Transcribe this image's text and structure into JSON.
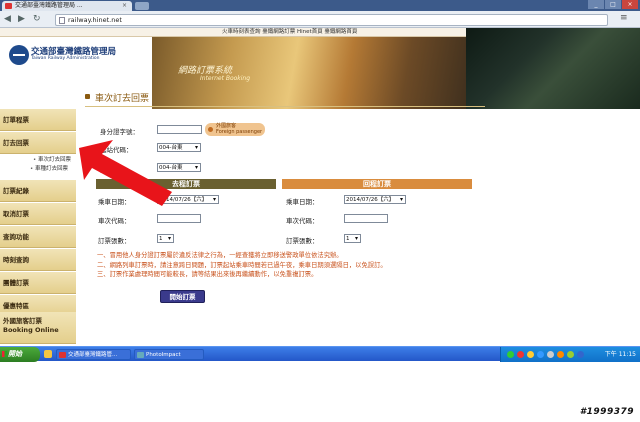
{
  "browser": {
    "tab_title": "交通部臺灣鐵路管理局 ...",
    "tab_close": "×",
    "url": "railway.hinet.net",
    "back": "◀",
    "forward": "▶",
    "reload": "↻",
    "star": "☆",
    "menu": "≡",
    "win_min": "_",
    "win_max": "□",
    "win_close": "×"
  },
  "header": {
    "top_links": "火車時刻表查詢  臺鐵網路訂票  Hinet首頁  臺鐵網路首頁",
    "org_name": "交通部臺灣鐵路管理局",
    "org_name_en": "Taiwan Railway Administration",
    "banner_title": "網路訂票系統",
    "banner_sub": "Internet Booking"
  },
  "sidebar": {
    "items": [
      {
        "label": "訂單程票"
      },
      {
        "label": "訂去回票"
      },
      {
        "label": "訂票紀錄"
      },
      {
        "label": "取消訂票"
      },
      {
        "label": "查詢功能"
      },
      {
        "label": "時刻查詢"
      },
      {
        "label": "團體訂票"
      },
      {
        "label": "優惠特區"
      },
      {
        "label": "外國旅客訂票"
      },
      {
        "label": "Booking Online"
      }
    ],
    "sub_items": [
      {
        "label": "車次訂去回票"
      },
      {
        "label": "車種訂去回票"
      }
    ]
  },
  "form": {
    "section_title": "車次訂去回票",
    "id_label": "身分證字號：",
    "foreign_btn_zh": "外國旅客",
    "foreign_btn_en": "Foreign passenger",
    "from_label": "起站代碼：",
    "from_value": "004-台東",
    "to_label": "到站代碼：",
    "to_value": "004-台東",
    "go_head": "去程訂票",
    "ret_head": "回程訂票",
    "go": {
      "date_label": "乘車日期：",
      "date_value": "2014/07/26【六】",
      "train_label": "車次代碼：",
      "qty_label": "訂票張數：",
      "qty_value": "1"
    },
    "ret": {
      "date_label": "乘車日期：",
      "date_value": "2014/07/26【六】",
      "train_label": "車次代碼：",
      "qty_label": "訂票張數：",
      "qty_value": "1"
    },
    "notes": [
      "一、冒用他人身分證訂票屬於違反法律之行為，一經查獲將立即移送警政單位依法究辦。",
      "二、網路列車訂票時，請注意跨日問題，訂票起站乘車時間若已過午夜，乘車日期須選隔日，以免誤訂。",
      "三、訂票作業處理時間可能較長，請等結果出來後再繼續動作，以免重複訂票。"
    ],
    "start_btn": "開始訂票"
  },
  "taskbar": {
    "start": "開始",
    "tasks": [
      {
        "label": "交通部臺灣鐵路管..."
      },
      {
        "label": "PhotoImpact"
      }
    ],
    "clock": "下午 11:15"
  },
  "watermark": "#1999379",
  "colors": {
    "accent_red": "#e8141a",
    "sidebar_gold": "#e4cf8c",
    "go_header": "#6a6030",
    "ret_header": "#d98c3e",
    "notes_orange": "#c8501a"
  }
}
